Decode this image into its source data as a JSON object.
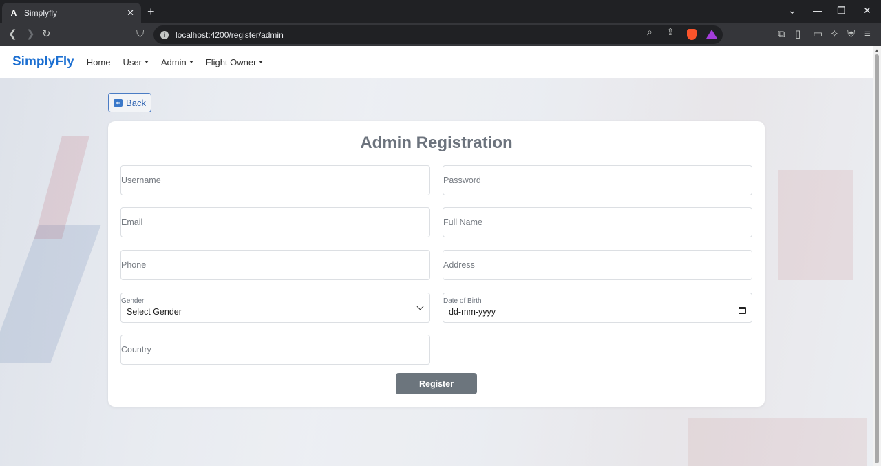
{
  "browser": {
    "tab_title": "Simplyfly",
    "tab_close": "✕",
    "new_tab": "+",
    "url": "localhost:4200/register/admin"
  },
  "navbar": {
    "brand": "SimplyFly",
    "links": [
      {
        "label": "Home",
        "dropdown": false
      },
      {
        "label": "User",
        "dropdown": true
      },
      {
        "label": "Admin",
        "dropdown": true
      },
      {
        "label": "Flight Owner",
        "dropdown": true
      }
    ]
  },
  "back_button": {
    "label": "Back"
  },
  "form": {
    "title": "Admin Registration",
    "username_placeholder": "Username",
    "password_placeholder": "Password",
    "email_placeholder": "Email",
    "fullname_placeholder": "Full Name",
    "phone_placeholder": "Phone",
    "address_placeholder": "Address",
    "gender_label": "Gender",
    "gender_value": "Select Gender",
    "dob_label": "Date of Birth",
    "dob_value": "dd-mm-yyyy",
    "country_placeholder": "Country",
    "submit_label": "Register"
  },
  "colors": {
    "brand": "#1c6fd1",
    "submit_bg": "#6c757d",
    "title": "#6c737d"
  }
}
